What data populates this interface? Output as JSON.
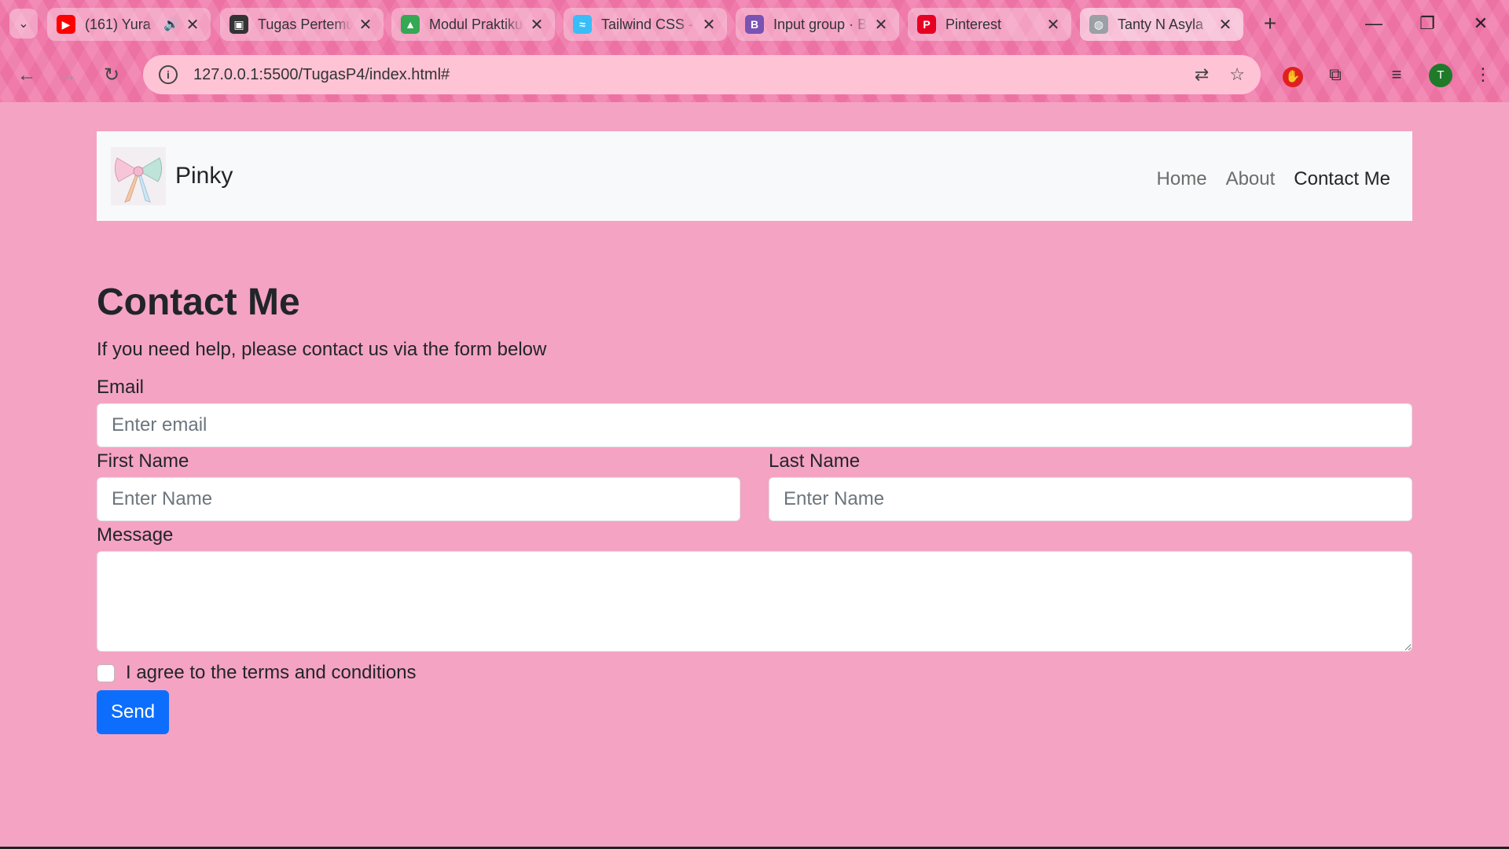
{
  "browser": {
    "tabs": [
      {
        "title": "(161) Yura",
        "icon": "youtube-icon",
        "color": "#ff0000",
        "glyph": "▶",
        "audio": true
      },
      {
        "title": "Tugas Pertemuan",
        "icon": "classroom-icon",
        "color": "#333333",
        "glyph": "▣"
      },
      {
        "title": "Modul Praktikum",
        "icon": "google-drive-icon",
        "color": "#34a853",
        "glyph": "▲"
      },
      {
        "title": "Tailwind CSS - ",
        "icon": "tailwind-icon",
        "color": "#38bdf8",
        "glyph": "≈"
      },
      {
        "title": "Input group · B",
        "icon": "bootstrap-icon",
        "color": "#7952b3",
        "glyph": "B"
      },
      {
        "title": "Pinterest",
        "icon": "pinterest-icon",
        "color": "#e60023",
        "glyph": "P"
      },
      {
        "title": "Tanty N Asyla",
        "icon": "globe-icon",
        "color": "#9aa0a6",
        "glyph": "◍",
        "active": true
      }
    ],
    "url": "127.0.0.1:5500/TugasP4/index.html#",
    "profile_initial": "T"
  },
  "navbar": {
    "brand": "Pinky",
    "links": [
      {
        "label": "Home",
        "active": false
      },
      {
        "label": "About",
        "active": false
      },
      {
        "label": "Contact Me",
        "active": true
      }
    ]
  },
  "contact": {
    "title": "Contact Me",
    "subtitle": "If you need help, please contact us via the form below",
    "email_label": "Email",
    "email_placeholder": "Enter email",
    "first_name_label": "First Name",
    "first_name_placeholder": "Enter Name",
    "last_name_label": "Last Name",
    "last_name_placeholder": "Enter Name",
    "message_label": "Message",
    "message_value": "",
    "terms_label": "I agree to the terms and conditions",
    "terms_checked": false,
    "send_label": "Send"
  },
  "colors": {
    "page_bg": "#f5a3c3",
    "navbar_bg": "#f8f9fa",
    "primary": "#0d6efd"
  }
}
